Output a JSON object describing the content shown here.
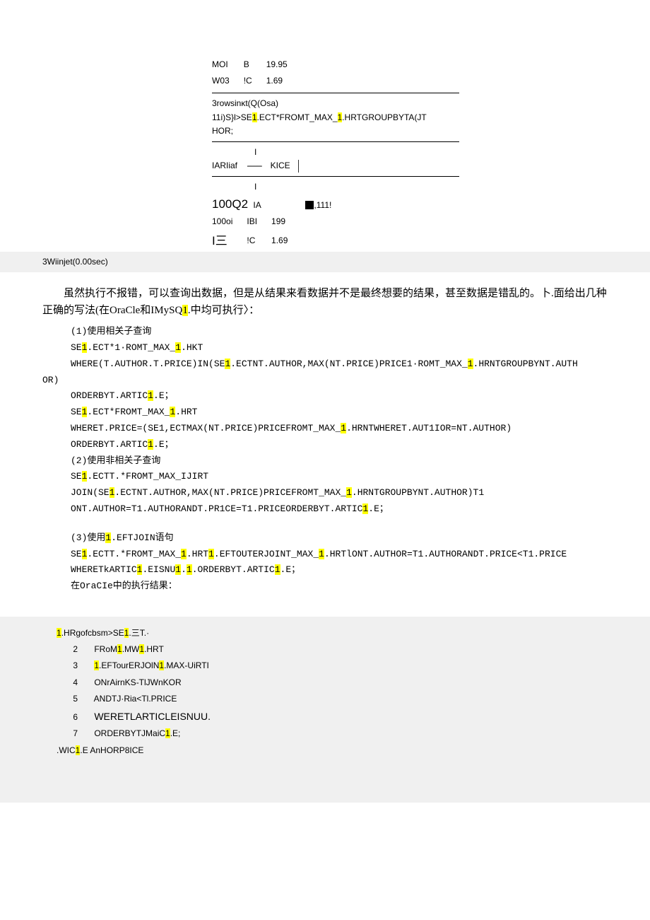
{
  "topTable": {
    "rows": [
      {
        "c1": "MOI",
        "c2": "B",
        "c3": "19.95"
      },
      {
        "c1": "W03",
        "c2": "!C",
        "c3": "1.69"
      }
    ],
    "midText1": "3rowsinκt(Q(Osa)",
    "midText2a": "11i)S}l>SE",
    "midText2b": ".ECT*FROMT_MAX_",
    "midText2c": ".HRTGROUPBYTA(JT",
    "midText3": "HOR;",
    "iarLabel": "IARIiaf",
    "kiceLabel": "KICE",
    "q100": "100Q2",
    "ia": "IA",
    "sup111": ",111!",
    "row2": {
      "c1": "100oi",
      "c2": "IBI",
      "c3": "199"
    },
    "row3": {
      "c1": "I三",
      "c2": "!C",
      "c3": "1.69"
    }
  },
  "grayLine": "3Wiinjet(0.00sec)",
  "paragraph1_a": "虽然执行不报错，可以查询出数据，但是从结果来看数据并不是最终想要的结果，甚至数据是错乱的。卜.面给出几种正确的写法(在OraCle和IMySQ",
  "paragraph1_b": ".中均可执行〉：",
  "section1": {
    "title": "(1)使用相关子查询",
    "l1a": "SE",
    "l1b": ".ECT*1·ROMT_MAX_",
    "l1c": ".HKT",
    "l2a": "WHERE(T.AUTHOR.T.PRICE)IN(SE",
    "l2b": ".ECTNT.AUTHOR,MAX(NT.PRICE)PRICE1·ROMT_MAX_",
    "l2c": ".HRNTGROUPBYNT.AUTH",
    "l2d": "OR)",
    "l3a": "ORDERBYT.ARTIC",
    "l3b": ".E；",
    "l4a": "SE",
    "l4b": ".ECT*FROMT_MAX_",
    "l4c": ".HRT",
    "l5a": "WHERET.PRICE=(SE1,ECTMAX(NT.PRICE)PRICEFROMT_MAX_",
    "l5b": ".HRNTWHERET.AUT1IOR=NT.AUTHOR)",
    "l6a": "ORDERBYT.ARTIC",
    "l6b": ".E；"
  },
  "section2": {
    "title": "(2)使用非相关子查询",
    "l1a": "SE",
    "l1b": ".ECTT.*FROMT_MAX_IJIRT",
    "l2a": "JOIN(SE",
    "l2b": ".ECTNT.AUTHOR,MAX(NT.PRICE)PRICEFROMT_MAX_",
    "l2c": ".HRNTGROUPBYNT.AUTHOR)T1",
    "l3a": "ONT.AUTHOR=T1.AUTHORANDT.PR1CE=T1.PRICEORDERBYT.ARTIC",
    "l3b": ".E；"
  },
  "section3": {
    "title_a": "(3)使用",
    "title_b": ".EFTJOIN语句",
    "l1a": "SE",
    "l1b": ".ECTT.*FROMT_MAX_",
    "l1c": ".HRT",
    "l1d": ".EFTOUTERJOINT_MAX_",
    "l1e": ".HRTlONT.AUTHOR=T1.AUTHORANDT.PRICE<T1.PRICE",
    "l2a": "WHERETkARTIC",
    "l2b": ".EISNU",
    "l2c": ".",
    "l2d": ".ORDERBYT.ARTIC",
    "l2e": ".E；",
    "result": "在OraCIe中的执行结果："
  },
  "bottom": {
    "l1a": ".HRgofcbsm>SE",
    "l1b": ".三T.·",
    "rows": [
      {
        "n": "2",
        "a": "FRoM",
        "b": ".MW",
        "c": ".HRT"
      },
      {
        "n": "3",
        "a": "",
        "b": ".EFTourERJOlN",
        "c": ".MAX-UiRTI"
      },
      {
        "n": "4",
        "a": "ONrAirnKS-TlJWnKOR",
        "b": "",
        "c": ""
      },
      {
        "n": "5",
        "a": "ANDTJ·Ria<Tl.PRICE",
        "b": "",
        "c": ""
      },
      {
        "n": "6",
        "a": "WERETLARTICLEISNUU.",
        "b": "",
        "c": ""
      },
      {
        "n": "7",
        "a": "ORDERBYTJMaiC",
        "b": ".E;",
        "c": ""
      }
    ],
    "lastA": ".WIC",
    "lastB": ".E  AnHORP8ICE"
  },
  "one": "1"
}
